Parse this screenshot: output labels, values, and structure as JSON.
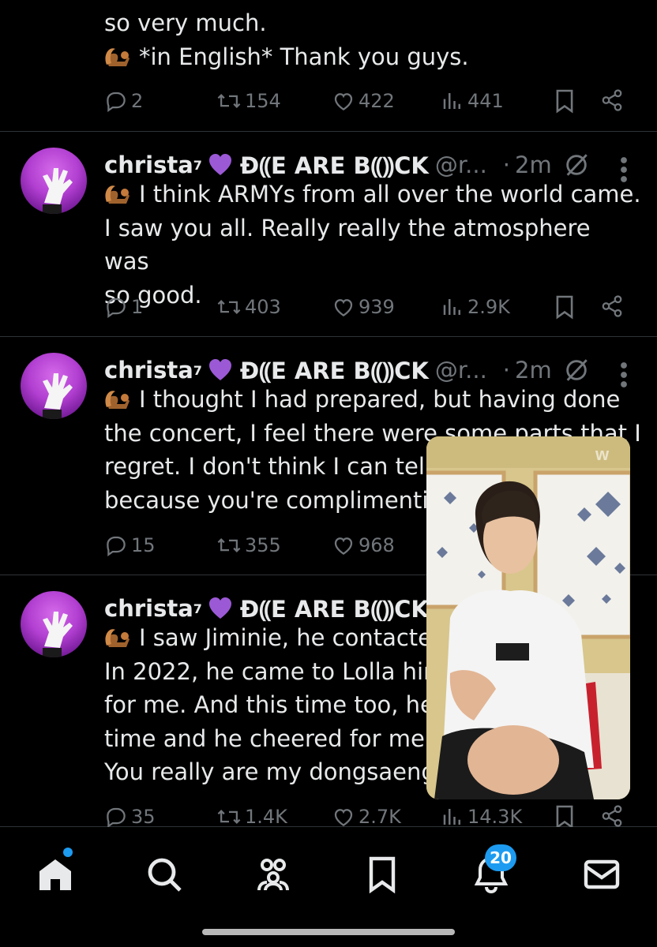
{
  "colors": {
    "accent": "#1d9bf0",
    "muted": "#71767b",
    "text": "#e7e9ea",
    "bg": "#000000",
    "avatar": "#b23fd1"
  },
  "top_tweet": {
    "lines": [
      "so very much.",
      "*in English* Thank you guys."
    ],
    "replies": "2",
    "reposts": "154",
    "likes": "422",
    "views": "441"
  },
  "tweets": [
    {
      "name": "christa",
      "sup": "7",
      "banner": "Đ⸨E ARE B⸨⸩CK",
      "handle": "@r...",
      "time": "2m",
      "lines": [
        "I think ARMYs from all over the world came.",
        "I saw you all. Really really the atmosphere was",
        "so good."
      ],
      "replies": "1",
      "reposts": "403",
      "likes": "939",
      "views": "2.9K"
    },
    {
      "name": "christa",
      "sup": "7",
      "banner": "Đ⸨E ARE B⸨⸩CK",
      "handle": "@r...",
      "time": "2m",
      "lines": [
        "I thought I had prepared, but having done",
        "the concert, I feel there were some parts that I",
        "regret. I don't think I can tell y",
        "because you're complimenti"
      ],
      "replies": "15",
      "reposts": "355",
      "likes": "968",
      "views": ""
    },
    {
      "name": "christa",
      "sup": "7",
      "banner": "Đ⸨E ARE B⸨⸩CK",
      "handle": "",
      "time": "",
      "lines": [
        "I saw Jiminie, he contacte",
        "In 2022, he came to Lolla hin",
        "for me. And this time too, he",
        "time and he cheered for me.",
        "You really are my dongsaeng"
      ],
      "replies": "35",
      "reposts": "1.4K",
      "likes": "2.7K",
      "views": "14.3K"
    }
  ],
  "tabbar": {
    "notifications_badge": "20"
  },
  "icons": [
    "reply-icon",
    "repost-icon",
    "like-icon",
    "views-icon",
    "bookmark-icon",
    "share-icon",
    "grok-icon",
    "more-icon",
    "home-icon",
    "search-icon",
    "communities-icon",
    "bookmarks-icon",
    "notifications-icon",
    "messages-icon",
    "squirrel-emoji",
    "purple-heart-emoji"
  ]
}
